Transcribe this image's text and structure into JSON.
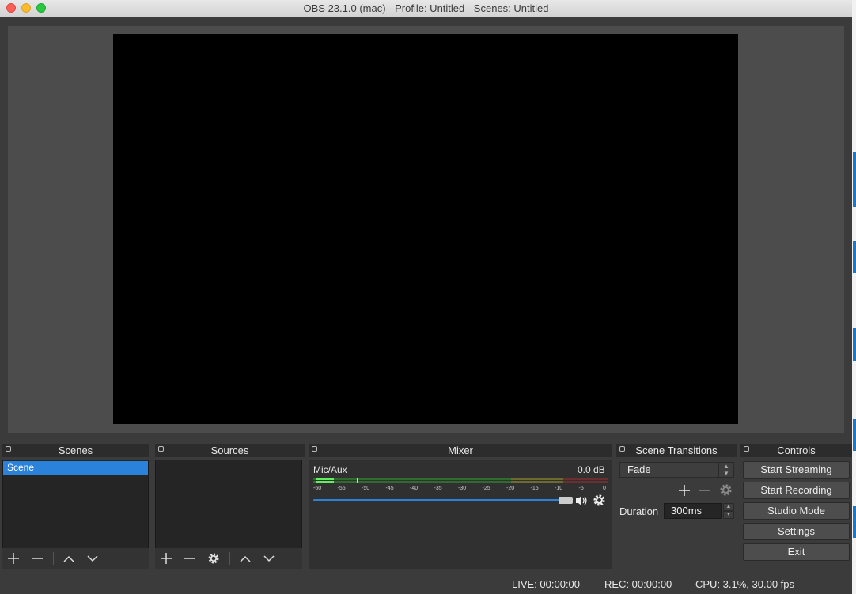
{
  "window": {
    "title": "OBS 23.1.0 (mac) - Profile: Untitled - Scenes: Untitled"
  },
  "docks": {
    "scenes": {
      "title": "Scenes",
      "items": [
        "Scene"
      ]
    },
    "sources": {
      "title": "Sources"
    },
    "mixer": {
      "title": "Mixer",
      "channel": "Mic/Aux",
      "level": "0.0 dB",
      "ticks": [
        "-60",
        "-55",
        "-50",
        "-45",
        "-40",
        "-35",
        "-30",
        "-25",
        "-20",
        "-15",
        "-10",
        "-5",
        "0"
      ],
      "volume_fraction": 1.0
    },
    "transitions": {
      "title": "Scene Transitions",
      "selected": "Fade",
      "duration_label": "Duration",
      "duration_value": "300ms"
    },
    "controls": {
      "title": "Controls",
      "buttons": [
        "Start Streaming",
        "Start Recording",
        "Studio Mode",
        "Settings",
        "Exit"
      ]
    }
  },
  "status": {
    "live": "LIVE: 00:00:00",
    "rec": "REC: 00:00:00",
    "cpu": "CPU: 3.1%, 30.00 fps"
  },
  "colors": {
    "accent": "#2a82da",
    "meter_green": "#3fbf3f",
    "meter_yellow": "#bfbf3f",
    "meter_red": "#bf3f3f"
  }
}
